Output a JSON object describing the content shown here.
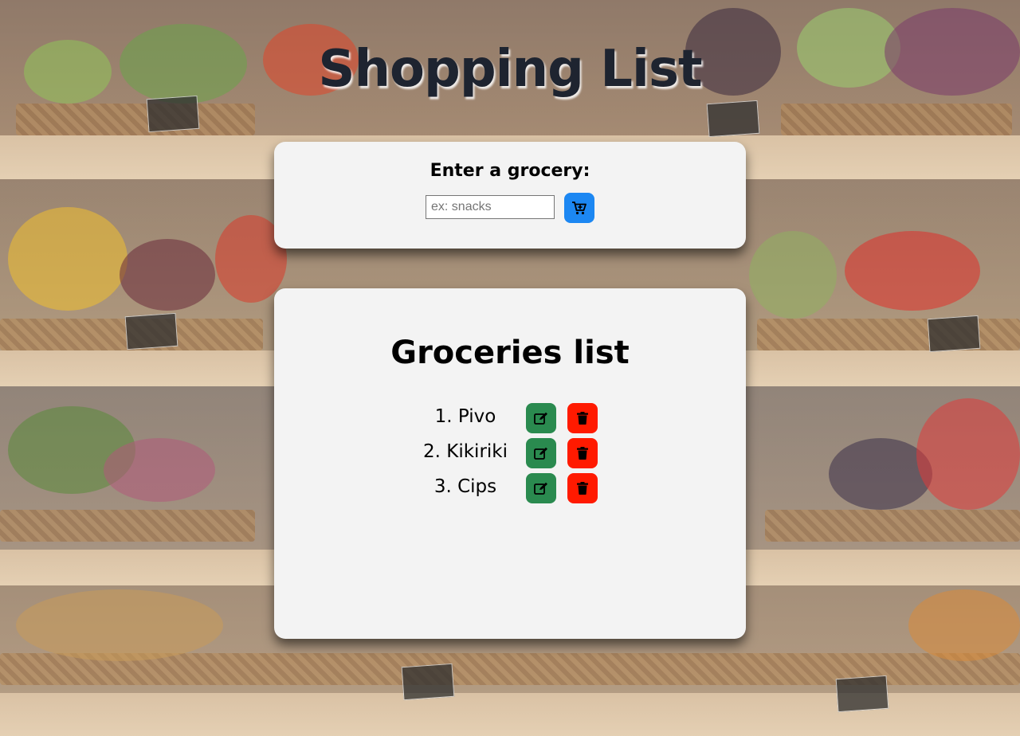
{
  "header": {
    "title": "Shopping List"
  },
  "input_card": {
    "label": "Enter a grocery:",
    "input_value": "",
    "input_placeholder": "ex: snacks",
    "add_icon": "cart-plus-icon"
  },
  "list_card": {
    "title": "Groceries list",
    "items": [
      {
        "label": "1. Pivo"
      },
      {
        "label": "2. Kikiriki"
      },
      {
        "label": "3. Cips"
      }
    ],
    "edit_icon": "edit-icon",
    "delete_icon": "trash-icon"
  },
  "colors": {
    "add_button": "#1c87f2",
    "edit_button": "#2a8a4f",
    "delete_button": "#ff1a00",
    "card_bg": "#f3f3f3",
    "title_text": "#1e2430"
  }
}
